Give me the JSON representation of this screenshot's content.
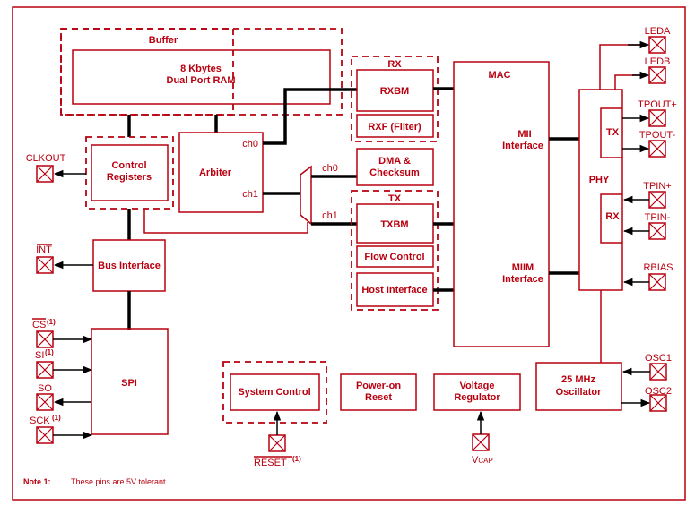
{
  "colors": {
    "line": "#b8000f",
    "bus": "#000000",
    "background": "#ffffff"
  },
  "blocks": {
    "buffer_group": "Buffer",
    "ram_line1": "8 Kbytes",
    "ram_line2": "Dual Port RAM",
    "control_line1": "Control",
    "control_line2": "Registers",
    "arbiter": "Arbiter",
    "arbiter_ch0": "ch0",
    "arbiter_ch1": "ch1",
    "mux_ch0": "ch0",
    "mux_ch1": "ch1",
    "bus_interface": "Bus Interface",
    "spi": "SPI",
    "rx_group": "RX",
    "rxbm": "RXBM",
    "rxf": "RXF (Filter)",
    "dma_line1": "DMA &",
    "dma_line2": "Checksum",
    "tx_group": "TX",
    "txbm": "TXBM",
    "flow_control": "Flow Control",
    "host_interface": "Host Interface",
    "mac": "MAC",
    "mii_line1": "MII",
    "mii_line2": "Interface",
    "miim_line1": "MIIM",
    "miim_line2": "Interface",
    "phy": "PHY",
    "phy_tx": "TX",
    "phy_rx": "RX",
    "osc_line1": "25 MHz",
    "osc_line2": "Oscillator",
    "system_control": "System Control",
    "por_line1": "Power-on",
    "por_line2": "Reset",
    "vreg_line1": "Voltage",
    "vreg_line2": "Regulator"
  },
  "pins": {
    "clkout": "CLKOUT",
    "int": "INT",
    "cs": "CS",
    "si": "SI",
    "so": "SO",
    "sck": "SCK",
    "note_ref": "(1)",
    "leda": "LEDA",
    "ledb": "LEDB",
    "tpout_plus": "TPOUT+",
    "tpout_minus": "TPOUT-",
    "tpin_plus": "TPIN+",
    "tpin_minus": "TPIN-",
    "rbias": "RBIAS",
    "osc1": "OSC1",
    "osc2": "OSC2",
    "reset": "RESET",
    "vcap_v": "V",
    "vcap_sub": "CAP"
  },
  "note": {
    "label": "Note 1:",
    "text": "These pins are 5V tolerant."
  }
}
